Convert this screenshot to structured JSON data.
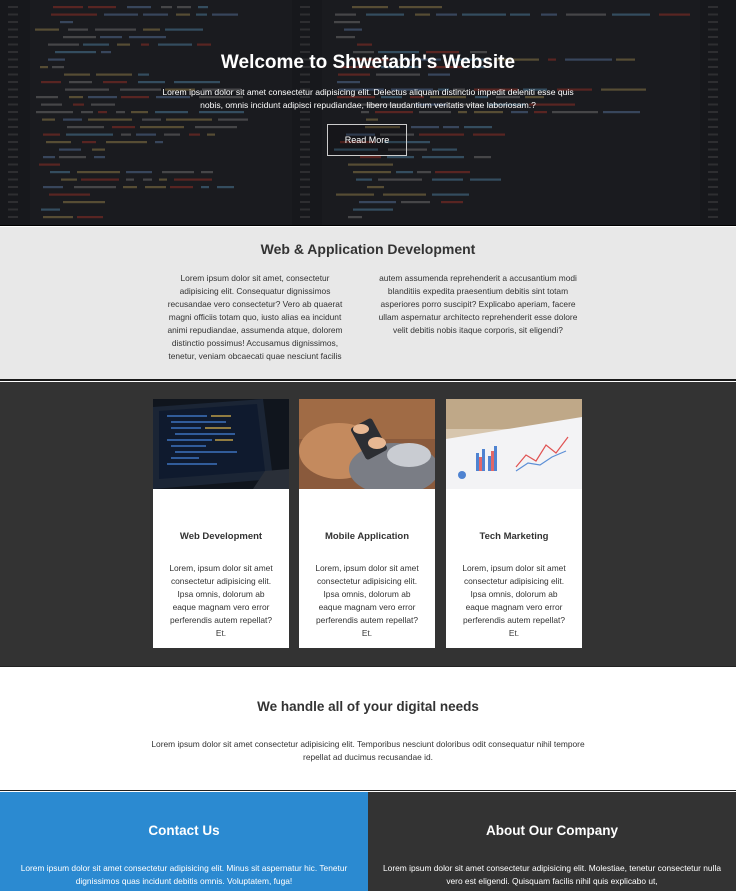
{
  "hero": {
    "title": "Welcome to Shwetabh's Website",
    "text": "Lorem ipsum dolor sit amet consectetur adipisicing elit. Delectus aliquam distinctio impedit deleniti esse quis nobis, omnis incidunt adipisci repudiandae, libero laudantium veritatis vitae laboriosam.?",
    "button_label": "Read More"
  },
  "development": {
    "title": "Web & Application Development",
    "col_left": "Lorem ipsum dolor sit amet, consectetur adipisicing elit. Consequatur dignissimos recusandae vero consectetur? Vero ab quaerat magni officiis totam quo, iusto alias ea incidunt animi repudiandae, assumenda atque, dolorem distinctio possimus! Accusamus dignissimos, tenetur, veniam obcaecati quae nesciunt facilis",
    "col_right": "autem assumenda reprehenderit a accusantium modi blanditiis expedita praesentium debitis sint totam asperiores porro suscipit? Explicabo aperiam, facere ullam aspernatur architecto reprehenderit esse dolore velit debitis nobis itaque corporis, sit eligendi?"
  },
  "services": [
    {
      "title": "Web Development",
      "text": "Lorem, ipsum dolor sit amet consectetur adipisicing elit. Ipsa omnis, dolorum ab eaque magnam vero error perferendis autem repellat? Et."
    },
    {
      "title": "Mobile Application",
      "text": "Lorem, ipsum dolor sit amet consectetur adipisicing elit. Ipsa omnis, dolorum ab eaque magnam vero error perferendis autem repellat? Et."
    },
    {
      "title": "Tech Marketing",
      "text": "Lorem, ipsum dolor sit amet consectetur adipisicing elit. Ipsa omnis, dolorum ab eaque magnam vero error perferendis autem repellat? Et."
    }
  ],
  "needs": {
    "title": "We handle all of your digital needs",
    "text": "Lorem ipsum dolor sit amet consectetur adipisicing elit. Temporibus nesciunt doloribus odit consequatur nihil tempore repellat ad ducimus recusandae id."
  },
  "contact": {
    "title": "Contact Us",
    "text": "Lorem ipsum dolor sit amet consectetur adipisicing elit. Minus sit aspernatur hic. Tenetur dignissimos quas incidunt debitis omnis. Voluptatem, fuga!"
  },
  "about": {
    "title": "About Our Company",
    "text": "Lorem ipsum dolor sit amet consectetur adipisicing elit. Molestiae, tenetur consectetur nulla vero est eligendi. Quisquam facilis nihil quis explicabo ut,"
  },
  "colors": {
    "contact_bg": "#2b8ad1",
    "dark_bg": "#333333",
    "light_bg": "#e8e8e8"
  }
}
